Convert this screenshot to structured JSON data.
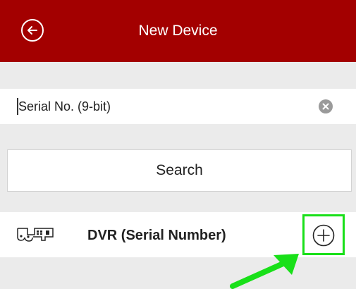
{
  "header": {
    "title": "New Device",
    "back_icon": "arrow-left-circle-icon",
    "background_color": "#a30000"
  },
  "serial_input": {
    "placeholder": "Serial No. (9-bit)",
    "value": "",
    "clear_icon": "clear-circle-icon"
  },
  "search": {
    "label": "Search"
  },
  "device_item": {
    "label": "DVR (Serial Number)",
    "device_icon": "dvr-icon",
    "add_icon": "plus-circle-icon"
  },
  "annotation": {
    "highlight_color": "#19e019",
    "arrow_icon": "green-arrow-icon"
  }
}
